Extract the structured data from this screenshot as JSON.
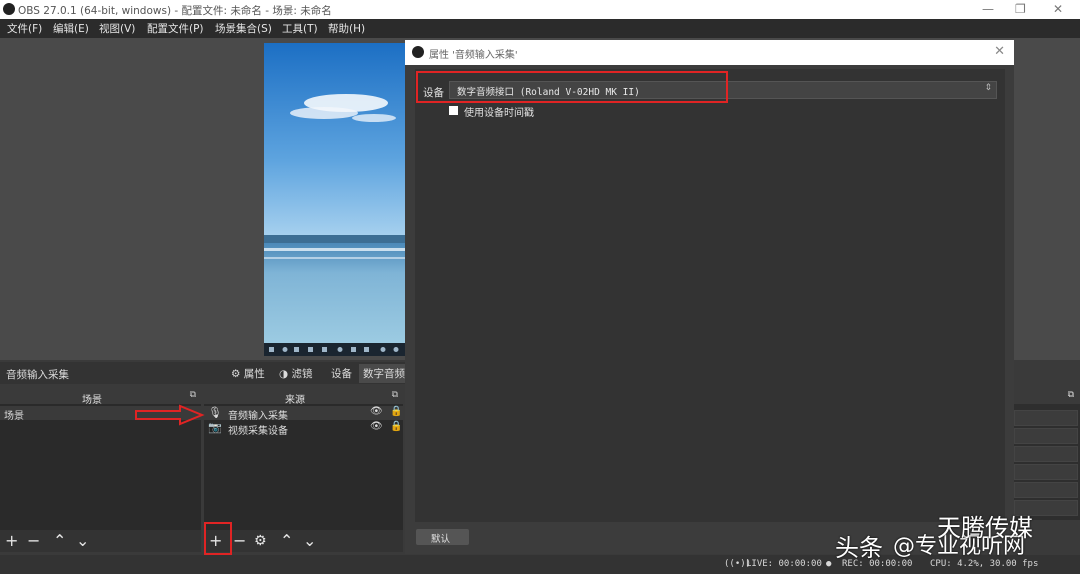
{
  "window": {
    "title": "OBS 27.0.1 (64-bit, windows) - 配置文件: 未命名 - 场景: 未命名"
  },
  "menu": [
    "文件(F)",
    "编辑(E)",
    "视图(V)",
    "配置文件(P)",
    "场景集合(S)",
    "工具(T)",
    "帮助(H)"
  ],
  "dialog": {
    "title": "属性 '音频输入采集'",
    "device_label": "设备",
    "device_value": "数字音频接口 (Roland V-02HD MK II)",
    "use_timestamp_label": "使用设备时间戳",
    "defaults_button": "默认"
  },
  "source_toolbar": {
    "selected_source": "音频输入采集",
    "properties": "属性",
    "filters": "滤镜",
    "device": "设备",
    "device_value": "数字音频"
  },
  "scenes": {
    "title": "场景",
    "items": [
      "场景"
    ]
  },
  "sources": {
    "title": "来源",
    "items": [
      {
        "name": "音频输入采集",
        "icon": "microphone-icon"
      },
      {
        "name": "视频采集设备",
        "icon": "camera-icon"
      }
    ]
  },
  "status": {
    "live": "LIVE: 00:00:00",
    "rec": "REC: 00:00:00",
    "cpu": "CPU: 4.2%, 30.00 fps"
  },
  "watermark": {
    "line1": "头条",
    "line2": "@专业视听网",
    "line3": "天腾传媒"
  },
  "colors": {
    "annotation": "#e02424",
    "panel": "#2a2a2a"
  }
}
